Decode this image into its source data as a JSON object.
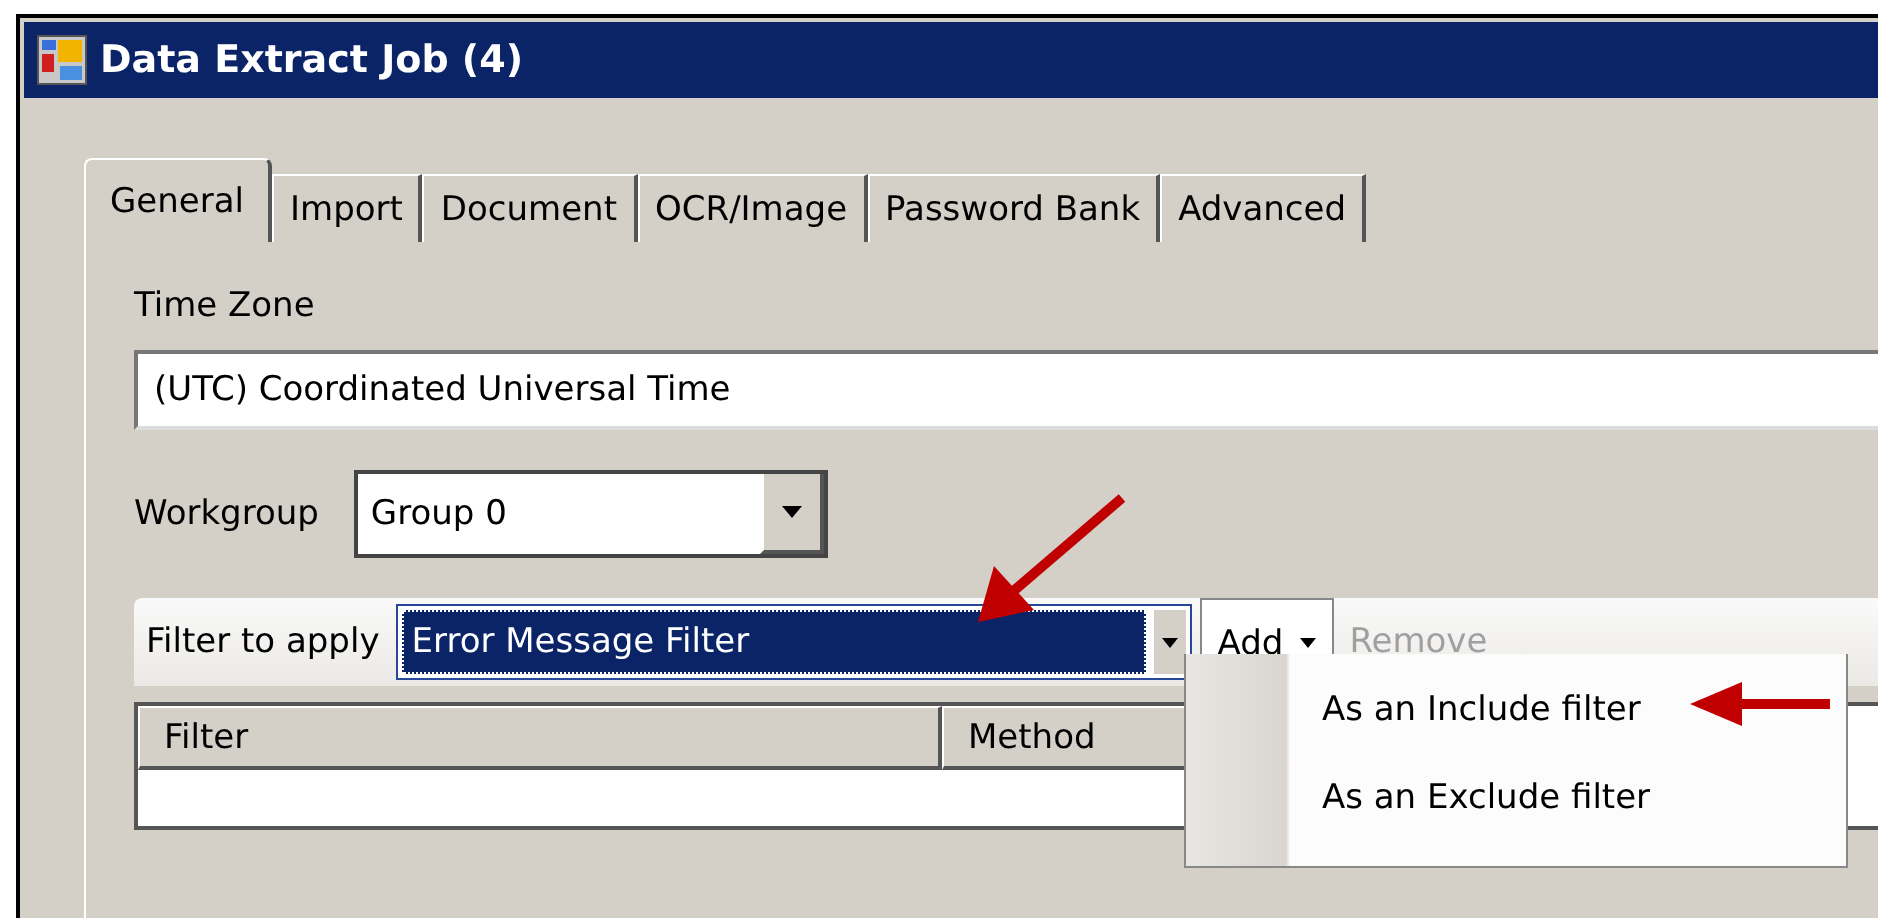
{
  "window": {
    "title": "Data Extract Job (4)"
  },
  "tabs": [
    {
      "label": "General",
      "selected": true
    },
    {
      "label": "Import",
      "selected": false
    },
    {
      "label": "Document",
      "selected": false
    },
    {
      "label": "OCR/Image",
      "selected": false
    },
    {
      "label": "Password Bank",
      "selected": false
    },
    {
      "label": "Advanced",
      "selected": false
    }
  ],
  "time_zone": {
    "label": "Time Zone",
    "value": "(UTC) Coordinated Universal Time"
  },
  "workgroup": {
    "label": "Workgroup",
    "value": "Group 0"
  },
  "filter_toolbar": {
    "label": "Filter to apply",
    "value": "Error Message Filter",
    "buttons": [
      {
        "label": "Add",
        "disabled": false,
        "dropdown": true
      },
      {
        "label": "Remove",
        "disabled": true,
        "dropdown": false
      }
    ]
  },
  "table": {
    "columns": [
      "Filter",
      "Method"
    ]
  },
  "add_menu": {
    "items": [
      "As an Include filter",
      "As an Exclude filter"
    ]
  }
}
